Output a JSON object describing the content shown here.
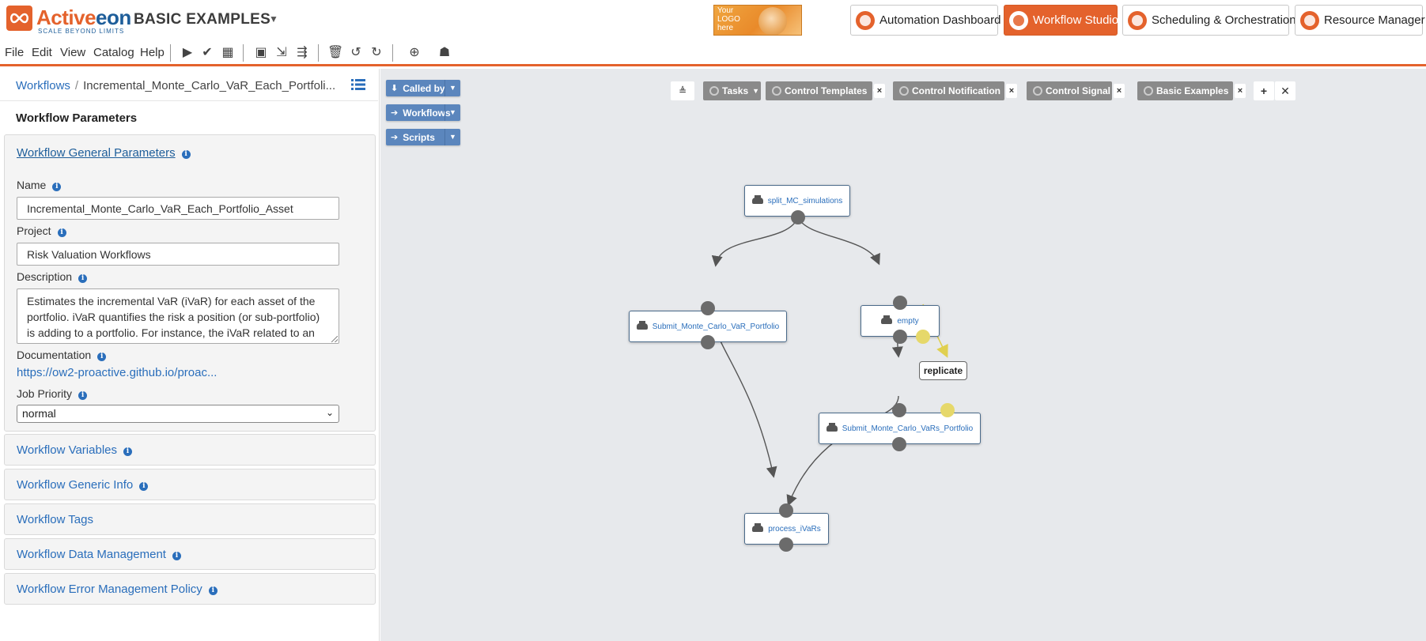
{
  "header": {
    "logo": {
      "name_part1": "Active",
      "name_part2": "eon",
      "tagline": "SCALE BEYOND LIMITS"
    },
    "bucket_title": "BASIC EXAMPLES",
    "placeholder_logo_text": "Your LOGO here",
    "portals": [
      {
        "label": "Automation Dashboard",
        "active": false
      },
      {
        "label": "Workflow Studio",
        "active": true
      },
      {
        "label": "Scheduling & Orchestration",
        "active": false
      },
      {
        "label": "Resource Manager",
        "active": false
      }
    ]
  },
  "menu": {
    "items": [
      "File",
      "Edit",
      "View",
      "Catalog",
      "Help"
    ],
    "toolbar_icons": [
      "play-icon",
      "check-icon",
      "calendar-icon",
      "save-icon",
      "export-icon",
      "publish-icon",
      "trash-icon",
      "undo-icon",
      "redo-icon",
      "catalog-global-icon",
      "catalog-user-icon"
    ]
  },
  "left_panel": {
    "breadcrumb": {
      "root": "Workflows",
      "separator": "/",
      "current": "Incremental_Monte_Carlo_VaR_Each_Portfoli..."
    },
    "title": "Workflow Parameters",
    "general": {
      "heading": "Workflow General Parameters",
      "name_label": "Name",
      "name_value": "Incremental_Monte_Carlo_VaR_Each_Portfolio_Asset",
      "project_label": "Project",
      "project_value": "Risk Valuation Workflows",
      "description_label": "Description",
      "description_value": "Estimates the incremental VaR (iVaR) for each asset of the portfolio. iVaR quantifies the risk a position (or sub-portfolio) is adding to a portfolio. For instance, the iVaR related to an",
      "documentation_label": "Documentation",
      "documentation_link": "https://ow2-proactive.github.io/proac...",
      "priority_label": "Job Priority",
      "priority_value": "normal"
    },
    "sections": [
      {
        "label": "Workflow Variables",
        "info": true
      },
      {
        "label": "Workflow Generic Info",
        "info": true
      },
      {
        "label": "Workflow Tags",
        "info": false
      },
      {
        "label": "Workflow Data Management",
        "info": true
      },
      {
        "label": "Workflow Error Management Policy",
        "info": true
      }
    ]
  },
  "canvas": {
    "side_buttons": [
      "Called by",
      "Workflows",
      "Scripts"
    ],
    "palettes": [
      {
        "label": "Tasks",
        "closable": false
      },
      {
        "label": "Control Templates",
        "closable": true
      },
      {
        "label": "Control Notification",
        "closable": true
      },
      {
        "label": "Control Signal",
        "closable": true
      },
      {
        "label": "Basic Examples",
        "closable": true
      }
    ],
    "add_palette": "+",
    "tasks": [
      "split_MC_simulations",
      "Submit_Monte_Carlo_VaR_Portfolio",
      "empty",
      "Submit_Monte_Carlo_VaRs_Portfolio",
      "process_iVaRs"
    ],
    "replicate_label": "replicate"
  }
}
